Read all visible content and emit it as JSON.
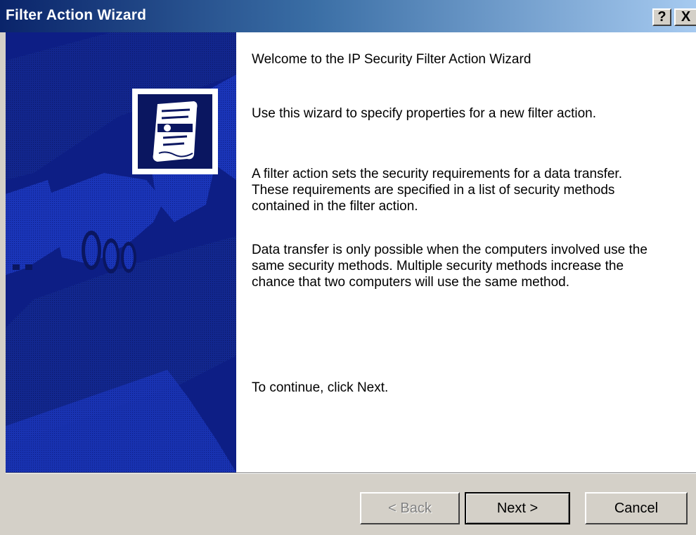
{
  "window": {
    "title": "Filter Action Wizard",
    "help_glyph": "?",
    "close_glyph": "X"
  },
  "content": {
    "heading": "Welcome to the IP Security Filter Action Wizard",
    "intro": "Use this wizard to specify properties for a new filter action.",
    "para1": "A filter action sets the security requirements for a data transfer. These requirements are specified in a list of security methods contained in the filter action.",
    "para2": "Data transfer is only possible when the computers involved use the same security methods. Multiple security methods increase the chance that two computers will use the same method.",
    "continue": "To continue, click Next."
  },
  "buttons": {
    "back": "< Back",
    "back_disabled": true,
    "next": "Next >",
    "cancel": "Cancel"
  },
  "colors": {
    "side_panel": "#0d1e85",
    "title_gradient_start": "#0a246a",
    "title_gradient_end": "#a6caf0"
  },
  "icons": {
    "wizard_graphic": "handshake-illustration",
    "logo": "certificate-scroll-icon"
  }
}
